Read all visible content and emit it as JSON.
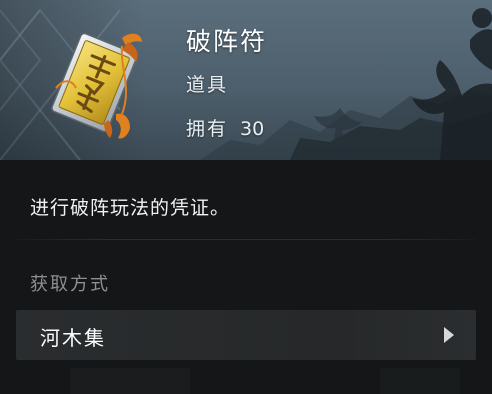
{
  "item": {
    "name": "破阵符",
    "type": "道具",
    "owned_label": "拥有",
    "owned_count": "30",
    "icon": "talisman-scroll-icon",
    "description": "进行破阵玩法的凭证。"
  },
  "obtain": {
    "header": "获取方式",
    "sources": [
      {
        "label": "河木集",
        "icon": "chevron-right-icon"
      }
    ]
  },
  "colors": {
    "header_bg": "#55687a",
    "panel_bg": "#141617",
    "row_bg": "#282b2d",
    "talisman_gold": "#e3c23a",
    "tassel_orange": "#e0801e"
  }
}
